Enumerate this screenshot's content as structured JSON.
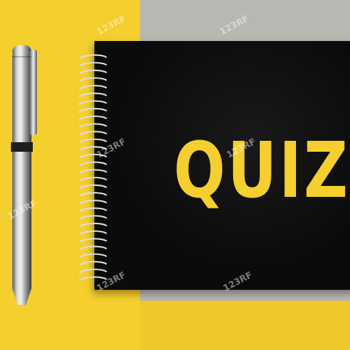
{
  "image": {
    "description_items": [
      "pen",
      "spiral notebook"
    ],
    "cover_text": "QUIZ",
    "watermarks": [
      "123RF",
      "123RF",
      "123RF",
      "123RF",
      "123RF",
      "123RF",
      "123RF"
    ],
    "colors": {
      "background_yellow": "#f4cf2e",
      "background_gray": "#b9b7b1",
      "notebook_cover": "#0b0b0b",
      "text_yellow": "#f5cf2f",
      "spiral_silver": "#d9d9d9"
    }
  }
}
